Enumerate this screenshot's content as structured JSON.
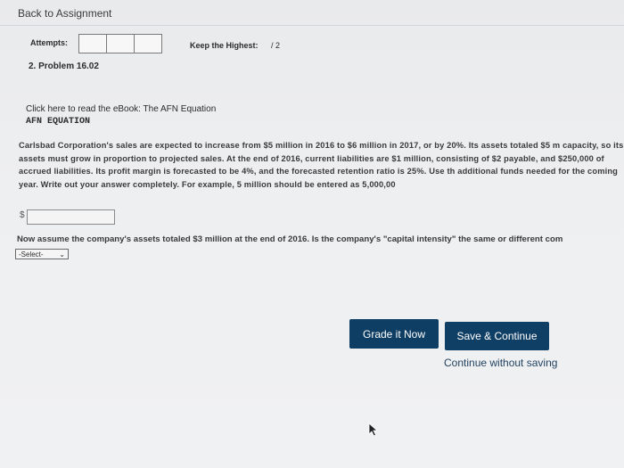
{
  "header": {
    "back_link": "Back to Assignment"
  },
  "attempts": {
    "label": "Attempts:",
    "boxes": [
      "",
      "",
      ""
    ],
    "keep_label": "Keep the Highest:",
    "keep_value": "/ 2"
  },
  "problem": {
    "title": "2. Problem 16.02",
    "ebook_link": "Click here to read the eBook: The AFN Equation",
    "section_heading": "AFN EQUATION",
    "paragraph": "Carlsbad Corporation's sales are expected to increase from $5 million in 2016 to $6 million in 2017, or by 20%. Its assets totaled $5 m capacity, so its assets must grow in proportion to projected sales. At the end of 2016, current liabilities are $1 million, consisting of $2 payable, and $250,000 of accrued liabilities. Its profit margin is forecasted to be 4%, and the forecasted retention ratio is 25%. Use th additional funds needed for the coming year. Write out your answer completely. For example, 5 million should be entered as 5,000,00",
    "currency_symbol": "$",
    "answer_value": "",
    "question2": "Now assume the company's assets totaled $3 million at the end of 2016. Is the company's \"capital intensity\" the same or different com",
    "select_value": "-Select-"
  },
  "actions": {
    "grade_label": "Grade it Now",
    "save_label": "Save & Continue",
    "continue_label": "Continue without saving"
  },
  "colors": {
    "button_bg": "#0e3e64",
    "page_bg": "#eeeff1"
  }
}
